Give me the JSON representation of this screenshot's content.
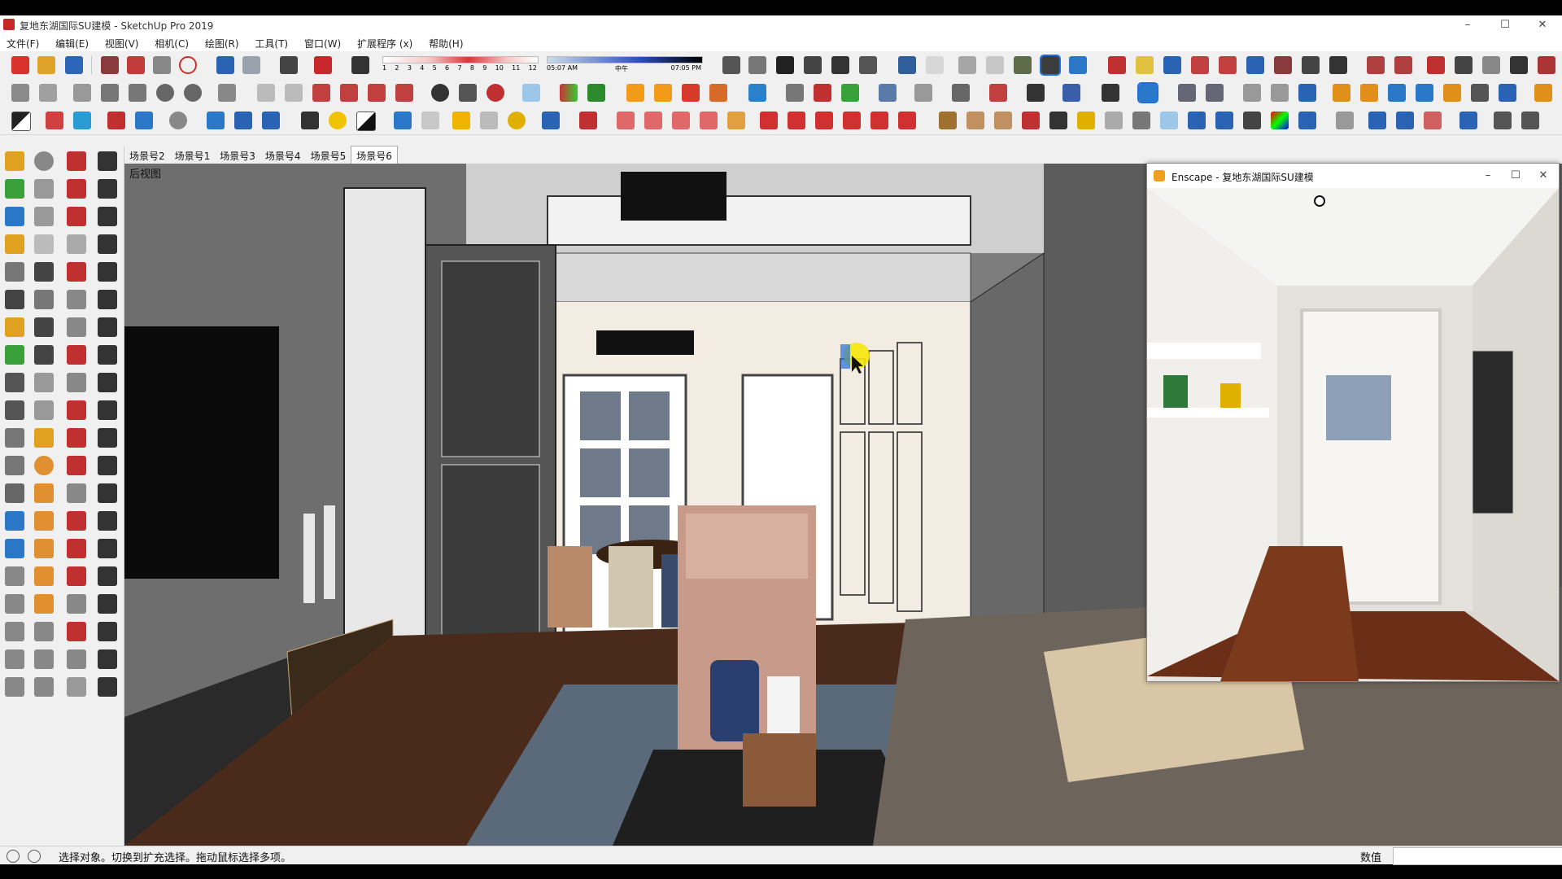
{
  "window": {
    "title": "复地东湖国际SU建模 - SketchUp Pro 2019",
    "minimize": "–",
    "maximize": "☐",
    "close": "✕"
  },
  "menu": [
    "文件(F)",
    "编辑(E)",
    "视图(V)",
    "相机(C)",
    "绘图(R)",
    "工具(T)",
    "窗口(W)",
    "扩展程序 (x)",
    "帮助(H)"
  ],
  "shadow": {
    "months": [
      "1",
      "2",
      "3",
      "4",
      "5",
      "6",
      "7",
      "8",
      "9",
      "10",
      "11",
      "12"
    ],
    "time_start": "05:07 AM",
    "noon": "中午",
    "time_end": "07:05 PM"
  },
  "scene_tabs": [
    "场景号2",
    "场景号1",
    "场景号3",
    "场景号4",
    "场景号5",
    "场景号6"
  ],
  "active_scene_index": 5,
  "viewport": {
    "label": "后视图"
  },
  "enscape": {
    "title": "Enscape - 复地东湖国际SU建模",
    "minimize": "–",
    "maximize": "☐",
    "close": "✕"
  },
  "status": {
    "text": "选择对象。切换到扩充选择。拖动鼠标选择多项。",
    "measure_label": "数值",
    "measure_value": ""
  },
  "colors": {
    "accent": "#1e6fd9",
    "highlight_yellow": "#f7e70a",
    "floor": "#4a2a1a",
    "wall": "#f3ece2"
  },
  "icons": {
    "toolbar": [
      "new-icon",
      "open-icon",
      "save-icon",
      "cut-icon",
      "copy-icon",
      "paste-icon",
      "delete-icon",
      "undo-icon",
      "redo-icon",
      "print-icon",
      "model-info-icon",
      "eraser-icon",
      "section-icon",
      "home-icon",
      "warehouse-icon",
      "extension-icon",
      "orbit-icon",
      "pan-icon",
      "zoom-icon",
      "zoom-window-icon",
      "zoom-extents-icon",
      "walk-icon",
      "look-around-icon",
      "render-icon"
    ],
    "left": [
      "select-icon",
      "component-icon",
      "paint-icon",
      "eraser-icon",
      "line-icon",
      "arc-icon",
      "rectangle-icon",
      "circle-icon",
      "polygon-icon",
      "push-pull-icon",
      "move-icon",
      "rotate-icon",
      "scale-icon",
      "offset-icon",
      "follow-me-icon",
      "tape-icon",
      "protractor-icon",
      "text-icon",
      "dimension-icon",
      "axes-icon"
    ]
  }
}
